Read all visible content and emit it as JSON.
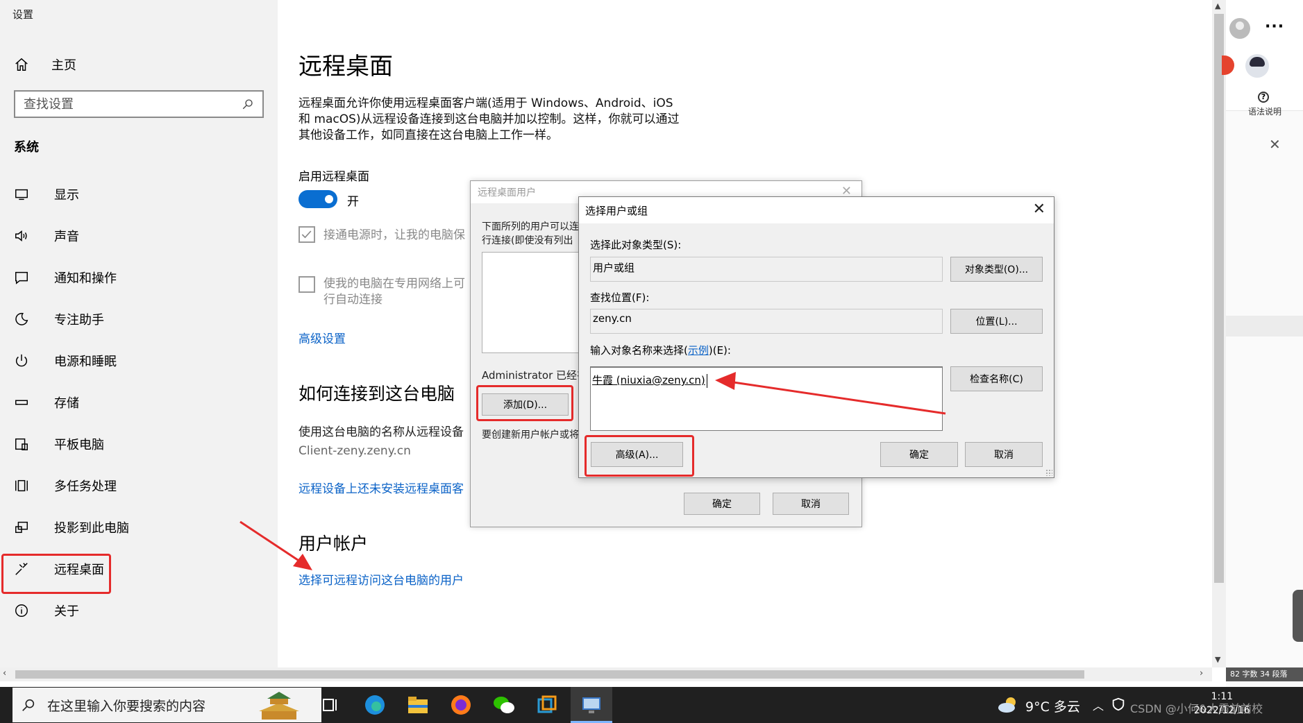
{
  "window_title": "设置",
  "sidebar": {
    "home_label": "主页",
    "search_placeholder": "查找设置",
    "section_title": "系统",
    "items": [
      {
        "label": "显示"
      },
      {
        "label": "声音"
      },
      {
        "label": "通知和操作"
      },
      {
        "label": "专注助手"
      },
      {
        "label": "电源和睡眠"
      },
      {
        "label": "存储"
      },
      {
        "label": "平板电脑"
      },
      {
        "label": "多任务处理"
      },
      {
        "label": "投影到此电脑"
      },
      {
        "label": "远程桌面"
      },
      {
        "label": "关于"
      }
    ]
  },
  "main": {
    "title": "远程桌面",
    "description_lines": [
      "远程桌面允许你使用远程桌面客户端(适用于 Windows、Android、iOS",
      "和 macOS)从远程设备连接到这台电脑并加以控制。这样，你就可以通过",
      "其他设备工作，如同直接在这台电脑上工作一样。"
    ],
    "enable_label": "启用远程桌面",
    "toggle_state": "开",
    "checkbox1_text": "接通电源时，让我的电脑保",
    "checkbox2_line1": "使我的电脑在专用网络上可",
    "checkbox2_line2": "行自动连接",
    "advanced_link": "高级设置",
    "how_to_title": "如何连接到这台电脑",
    "how_to_text": "使用这台电脑的名称从远程设备",
    "pc_name": "Client-zeny.zeny.cn",
    "no_client_link": "远程设备上还未安装远程桌面客",
    "accounts_title": "用户帐户",
    "select_users_link": "选择可远程访问这台电脑的用户"
  },
  "rdp_users_dialog": {
    "title": "远程桌面用户",
    "text_line1": "下面所列的用户可以连",
    "text_line2": "行连接(即使没有列出",
    "admin_text": "Administrator 已经有",
    "add_button": "添加(D)...",
    "create_text": "要创建新用户帐户或将",
    "ok_button": "确定",
    "cancel_button": "取消"
  },
  "select_dialog": {
    "title": "选择用户或组",
    "object_type_label": "选择此对象类型(S):",
    "object_type_value": "用户或组",
    "object_types_button": "对象类型(O)...",
    "location_label": "查找位置(F):",
    "location_value": "zeny.cn",
    "locations_button": "位置(L)...",
    "enter_names_label_before": "输入对象名称来选择(",
    "enter_names_link": "示例",
    "enter_names_label_after": ")(E):",
    "entered_name": "牛霞 (niuxia@zeny.cn)",
    "check_names_button": "检查名称(C)",
    "advanced_button": "高级(A)...",
    "ok_button": "确定",
    "cancel_button": "取消"
  },
  "right_panel": {
    "more_label": "···",
    "help_label": "语法说明",
    "footer": "82 字数  34 段落"
  },
  "taskbar": {
    "search_placeholder": "在这里输入你要搜索的内容",
    "weather": "9°C 多云",
    "time": "1:11",
    "date": "2022/12/16",
    "watermark": "CSDN @小何&大霞前前校"
  },
  "colors": {
    "accent": "#0a6ed1",
    "link": "#0a62c7",
    "annotation_red": "#e52b2b",
    "sidebar_bg": "#f2f2f2",
    "dialog_bg": "#f0f0f0"
  }
}
